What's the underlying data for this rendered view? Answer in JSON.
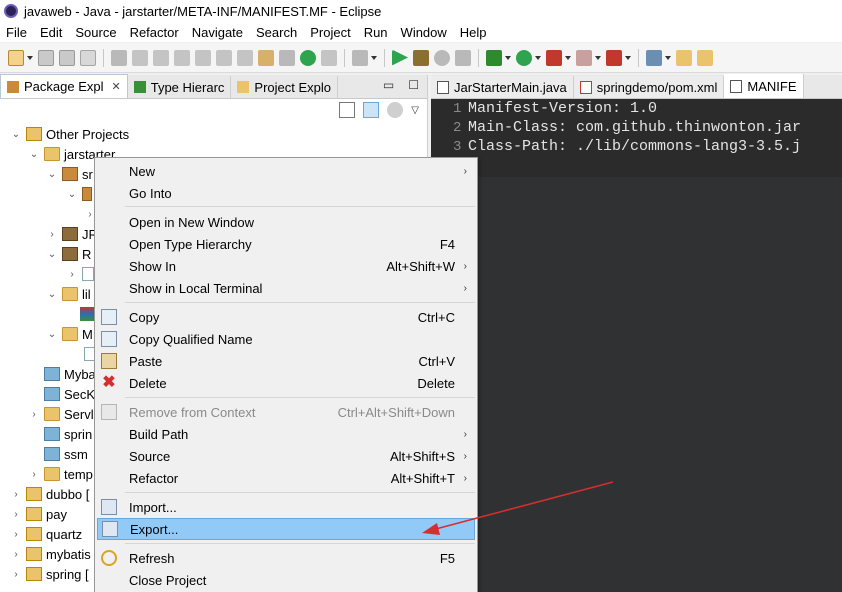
{
  "window": {
    "title": "javaweb - Java - jarstarter/META-INF/MANIFEST.MF - Eclipse"
  },
  "menubar": [
    "File",
    "Edit",
    "Source",
    "Refactor",
    "Navigate",
    "Search",
    "Project",
    "Run",
    "Window",
    "Help"
  ],
  "left_view": {
    "tabs": [
      {
        "label": "Package Expl",
        "close": "✕"
      },
      {
        "label": "Type Hierarc"
      },
      {
        "label": "Project Explo"
      }
    ],
    "min_symbol": "▭",
    "max_symbol": "☐"
  },
  "tree": {
    "other_projects": "Other Projects",
    "jarstarter": "jarstarter",
    "src": "sr",
    "jre": "JR",
    "res": "R",
    "lib": "lil",
    "meta": "M",
    "mybatis_gen": "Myba",
    "seckill": "SecK",
    "servlet": "Servl",
    "spring_p": "sprin",
    "ssm": "ssm",
    "temp": "temp",
    "dubbo": "dubbo [",
    "pay": "pay",
    "quartz": "quartz",
    "mybatis": "mybatis",
    "spring": "spring ["
  },
  "editor": {
    "tabs": [
      {
        "label": "JarStarterMain.java"
      },
      {
        "label": "springdemo/pom.xml"
      },
      {
        "label": "MANIFE"
      }
    ],
    "lines": [
      {
        "num": "1",
        "text": "Manifest-Version: 1.0"
      },
      {
        "num": "2",
        "text": "Main-Class: com.github.thinwonton.jar"
      },
      {
        "num": "3",
        "text": "Class-Path: ./lib/commons-lang3-3.5.j"
      }
    ]
  },
  "context_menu": {
    "items": [
      {
        "label": "New",
        "shortcut": "",
        "submenu": "›"
      },
      {
        "label": "Go Into",
        "shortcut": ""
      },
      {
        "label": "Open in New Window",
        "shortcut": ""
      },
      {
        "label": "Open Type Hierarchy",
        "shortcut": "F4"
      },
      {
        "label": "Show In",
        "shortcut": "Alt+Shift+W",
        "submenu": "›"
      },
      {
        "label": "Show in Local Terminal",
        "shortcut": "",
        "submenu": "›"
      },
      {
        "label": "Copy",
        "shortcut": "Ctrl+C"
      },
      {
        "label": "Copy Qualified Name",
        "shortcut": ""
      },
      {
        "label": "Paste",
        "shortcut": "Ctrl+V"
      },
      {
        "label": "Delete",
        "shortcut": "Delete"
      },
      {
        "label": "Remove from Context",
        "shortcut": "Ctrl+Alt+Shift+Down"
      },
      {
        "label": "Build Path",
        "shortcut": "",
        "submenu": "›"
      },
      {
        "label": "Source",
        "shortcut": "Alt+Shift+S",
        "submenu": "›"
      },
      {
        "label": "Refactor",
        "shortcut": "Alt+Shift+T",
        "submenu": "›"
      },
      {
        "label": "Import...",
        "shortcut": ""
      },
      {
        "label": "Export...",
        "shortcut": ""
      },
      {
        "label": "Refresh",
        "shortcut": "F5"
      },
      {
        "label": "Close Project",
        "shortcut": ""
      }
    ]
  },
  "colors": {
    "selection": "#91c9f7",
    "editor_bg": "#2b2b2b",
    "annotation_arrow": "#d32f2f"
  }
}
